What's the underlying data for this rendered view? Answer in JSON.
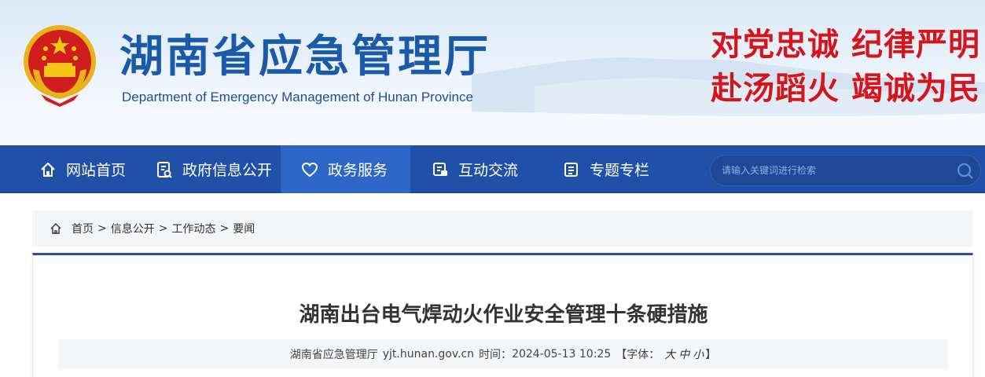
{
  "header": {
    "site_title": "湖南省应急管理厅",
    "site_subtitle": "Department of Emergency Management of Hunan Province",
    "slogan_line1": "对党忠诚 纪律严明",
    "slogan_line2": "赴汤蹈火 竭诚为民",
    "emblem_icon": "national-emblem-icon"
  },
  "colors": {
    "nav_bg": "#2150a8",
    "nav_active": "#2d66c6",
    "title_blue": "#1a5aa8",
    "slogan_red": "#d4161c"
  },
  "nav": {
    "items": [
      {
        "label": "网站首页",
        "icon": "home-icon"
      },
      {
        "label": "政府信息公开",
        "icon": "document-icon"
      },
      {
        "label": "政务服务",
        "icon": "heart-icon",
        "active": true
      },
      {
        "label": "互动交流",
        "icon": "chat-icon"
      },
      {
        "label": "专题专栏",
        "icon": "list-icon"
      }
    ],
    "search_placeholder": "请输入关键词进行检索"
  },
  "breadcrumb": {
    "items": [
      "首页",
      "信息公开",
      "工作动态",
      "要闻"
    ],
    "separator": ">"
  },
  "article": {
    "title": "湖南出台电气焊动火作业安全管理十条硬措施",
    "source": "湖南省应急管理厅",
    "site": "yjt.hunan.gov.cn",
    "time_label": "时间：",
    "time": "2024-05-13 10:25",
    "font_label": "【字体：",
    "font_large": "大",
    "font_medium": "中",
    "font_small": "小",
    "font_close": "】"
  }
}
